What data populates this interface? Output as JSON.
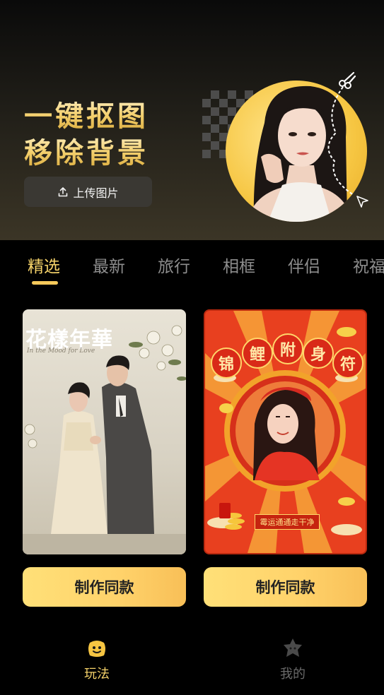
{
  "banner": {
    "title_line1": "一键抠图",
    "title_line2": "移除背景",
    "upload_label": "上传图片"
  },
  "tabs": [
    {
      "label": "精选",
      "active": true
    },
    {
      "label": "最新",
      "active": false
    },
    {
      "label": "旅行",
      "active": false
    },
    {
      "label": "相框",
      "active": false
    },
    {
      "label": "伴侣",
      "active": false
    },
    {
      "label": "祝福",
      "active": false
    }
  ],
  "cards": [
    {
      "title": "花樣年華",
      "subtitle": "In the Mood for Love",
      "button_label": "制作同款"
    },
    {
      "badges": [
        "锦",
        "鲤",
        "附",
        "身",
        "符"
      ],
      "banner_text": "霉运通通走干净",
      "button_label": "制作同款"
    }
  ],
  "bottom_nav": [
    {
      "label": "玩法",
      "icon": "smiley-icon",
      "active": true
    },
    {
      "label": "我的",
      "icon": "star-face-icon",
      "active": false
    }
  ],
  "colors": {
    "accent": "#f6d36a",
    "button_gradient_start": "#ffe078",
    "button_gradient_end": "#f8bf57",
    "inactive": "#8d8d8d"
  }
}
